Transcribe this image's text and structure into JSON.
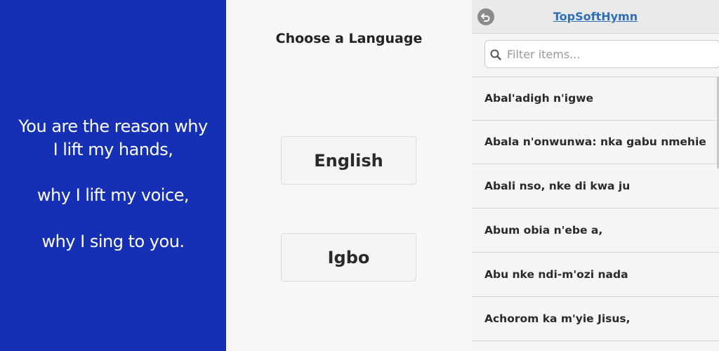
{
  "lyrics": {
    "lines": [
      "You are the reason why",
      "I lift my hands,",
      "why I lift my voice,",
      "why I sing to you."
    ],
    "background_color": "#1530b4"
  },
  "language_chooser": {
    "title": "Choose a Language",
    "buttons": [
      "English",
      "Igbo"
    ]
  },
  "hymn_list": {
    "header": {
      "back_icon": "back-arrow-icon",
      "title": "TopSoftHymn"
    },
    "search": {
      "placeholder": "Filter items...",
      "value": "",
      "icon": "search-icon"
    },
    "items": [
      "Abal'adigh n'igwe",
      "Abala n'onwunwa: nka gabu nmehie",
      "Abali nso, nke di kwa ju",
      "Abum obia n'ebe a,",
      "Abu nke ndi-m'ozi nada",
      "Achorom ka m'yie Jisus,"
    ],
    "link_color": "#2f6fb8"
  }
}
